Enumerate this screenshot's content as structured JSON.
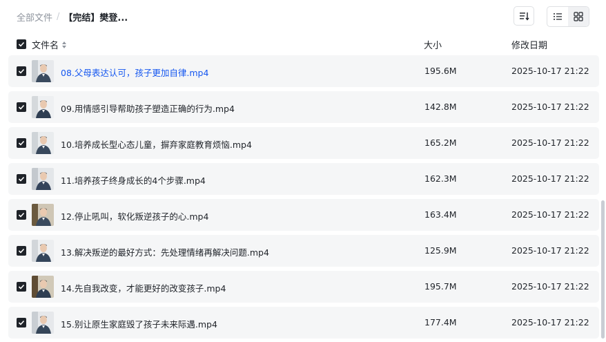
{
  "breadcrumb": {
    "root": "全部文件",
    "separator": "/",
    "current": "【完结】樊登..."
  },
  "toolbar": {
    "sort_icon": "sort-lines-icon",
    "list_view_icon": "list-view-icon",
    "grid_view_icon": "grid-view-icon"
  },
  "table": {
    "columns": {
      "name": "文件名",
      "size": "大小",
      "modified": "修改日期"
    },
    "rows": [
      {
        "name": "08.父母表达认可，孩子更加自律.mp4",
        "size": "195.6M",
        "modified": "2025-10-17 21:22",
        "highlighted": true
      },
      {
        "name": "09.用情感引导帮助孩子塑造正确的行为.mp4",
        "size": "142.8M",
        "modified": "2025-10-17 21:22"
      },
      {
        "name": "10.培养成长型心态儿童，摒弃家庭教育烦恼.mp4",
        "size": "165.2M",
        "modified": "2025-10-17 21:22"
      },
      {
        "name": "11.培养孩子终身成长的4个步骤.mp4",
        "size": "162.3M",
        "modified": "2025-10-17 21:22"
      },
      {
        "name": "12.停止吼叫，软化叛逆孩子的心.mp4",
        "size": "163.4M",
        "modified": "2025-10-17 21:22"
      },
      {
        "name": "13.解决叛逆的最好方式：先处理情绪再解决问题.mp4",
        "size": "125.9M",
        "modified": "2025-10-17 21:22"
      },
      {
        "name": "14.先自我改变，才能更好的改变孩子.mp4",
        "size": "195.7M",
        "modified": "2025-10-17 21:22"
      },
      {
        "name": "15.别让原生家庭毁了孩子未来际遇.mp4",
        "size": "177.4M",
        "modified": "2025-10-17 21:22"
      }
    ]
  },
  "colors": {
    "accent": "#1456f0",
    "row_bg": "#f5f6f7",
    "text": "#1f2329",
    "muted": "#8f959e"
  }
}
